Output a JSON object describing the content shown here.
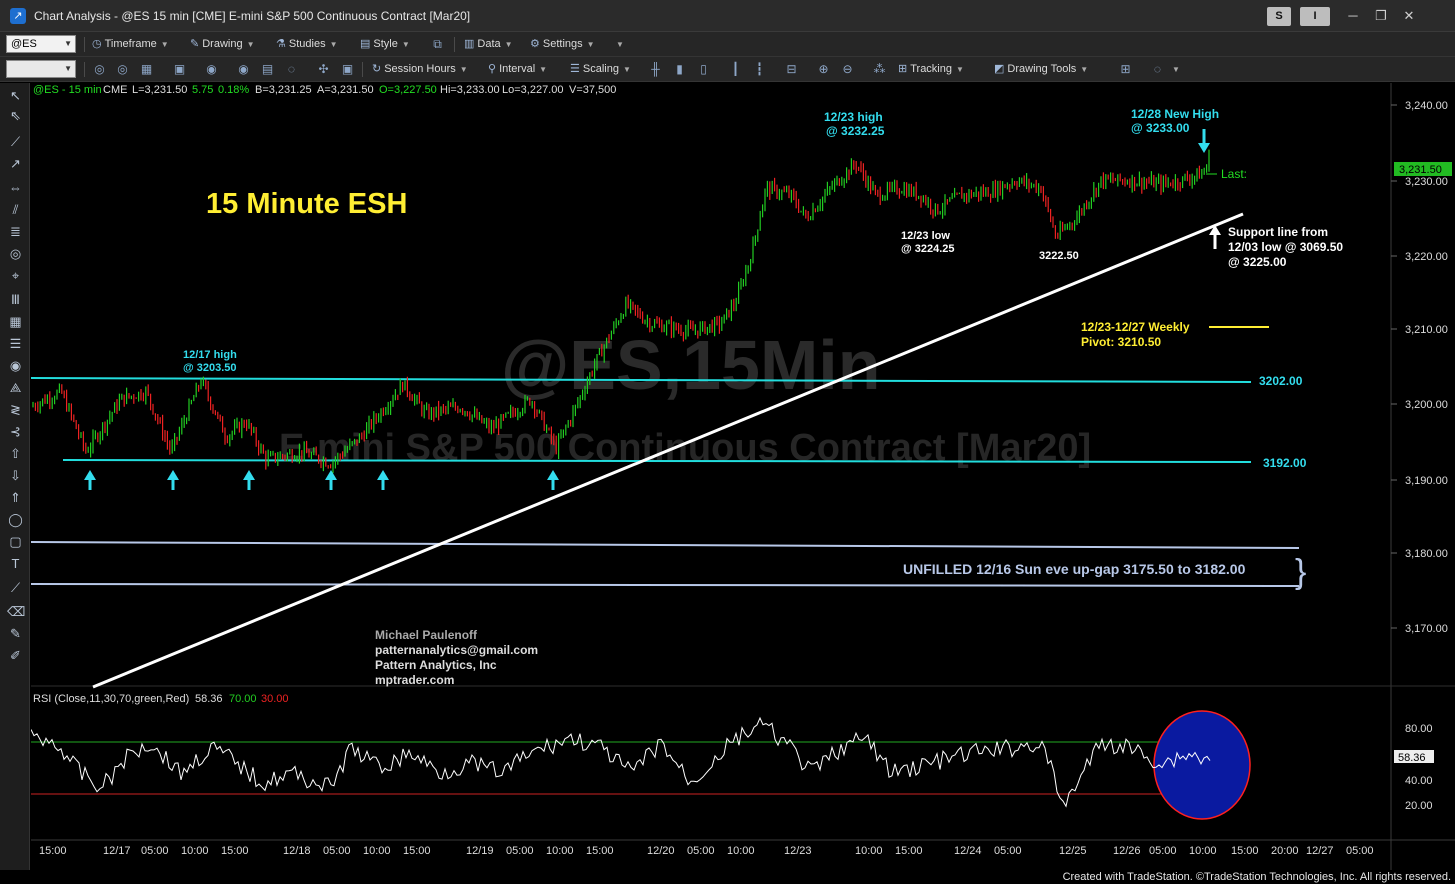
{
  "window": {
    "title": "Chart Analysis - @ES 15 min [CME] E-mini S&P 500 Continuous Contract [Mar20]",
    "s_button": "S",
    "i_button": "I",
    "minimize": "─",
    "restore": "❐",
    "close": "✕"
  },
  "toolbar1": {
    "symbol": "@ES",
    "items": [
      "Timeframe",
      "Drawing",
      "Studies",
      "Style",
      "Data",
      "Settings"
    ]
  },
  "toolbar2": {
    "items": [
      "Session Hours",
      "Interval",
      "Scaling",
      "Tracking",
      "Drawing Tools"
    ]
  },
  "quote_line": {
    "symbol": "@ES - 15 min",
    "exchange": "CME",
    "last": "L=3,231.50",
    "change": "5.75",
    "pct": "0.18%",
    "bid": "B=3,231.25",
    "ask": "A=3,231.50",
    "open": "O=3,227.50",
    "high": "Hi=3,233.00",
    "low": "Lo=3,227.00",
    "volume": "V=37,500"
  },
  "watermark": {
    "symbol": "@ES,15Min",
    "name": "E-mini S&P 500 Continuous Contract [Mar20]"
  },
  "annotations": {
    "title": "15 Minute ESH",
    "high_1223_l1": "12/23 high",
    "high_1223_l2": "@ 3232.25",
    "high_1228_l1": "12/28 New High",
    "high_1228_l2": "@ 3233.00",
    "high_1217_l1": "12/17 high",
    "high_1217_l2": "@ 3203.50",
    "low_1223_l1": "12/23 low",
    "low_1223_l2": "@ 3224.25",
    "low_3222": "3222.50",
    "support_l1": "Support line from",
    "support_l2": "12/03 low @ 3069.50",
    "support_l3": "@ 3225.00",
    "pivot_l1": "12/23-12/27 Weekly",
    "pivot_l2": "Pivot: 3210.50",
    "level_3202": "3202.00",
    "level_3192": "3192.00",
    "gap": "UNFILLED 12/16 Sun eve up-gap 3175.50 to 3182.00",
    "gap_brace": "}",
    "last_label": "Last:",
    "last_value": "3,231.50",
    "author": "Michael Paulenoff",
    "email": "patternanalytics@gmail.com",
    "company": "Pattern Analytics, Inc",
    "site": "mptrader.com"
  },
  "rsi": {
    "label": "RSI (Close,11,30,70,green,Red)",
    "value": "58.36",
    "overbought": "70.00",
    "oversold": "30.00",
    "axis_ticks": [
      "80.00",
      "40.00",
      "20.00"
    ],
    "current_tag": "58.36"
  },
  "price_axis": {
    "ticks": [
      "3,240.00",
      "3,230.00",
      "3,220.00",
      "3,210.00",
      "3,200.00",
      "3,190.00",
      "3,180.00",
      "3,170.00"
    ]
  },
  "time_axis": {
    "labels": [
      "15:00",
      "12/17",
      "05:00",
      "10:00",
      "15:00",
      "12/18",
      "05:00",
      "10:00",
      "15:00",
      "12/19",
      "05:00",
      "10:00",
      "15:00",
      "12/20",
      "05:00",
      "10:00",
      "12/23",
      "10:00",
      "15:00",
      "12/24",
      "05:00",
      "12/25",
      "12/26",
      "05:00",
      "10:00",
      "15:00",
      "20:00",
      "12/27",
      "05:00"
    ]
  },
  "footer": {
    "credits": "Created with TradeStation. ©TradeStation Technologies, Inc. All rights reserved."
  },
  "colors": {
    "up_bar": "#22cc22",
    "down_bar": "#ee2222",
    "cyan_lines": "#22dddd",
    "annotation_yellow": "#ffee33",
    "annotation_cyan": "#33ddee",
    "gap_lines": "#b8c8e8",
    "rsi_line": "#ffffff",
    "rsi_circle_fill": "#0a1aa0",
    "rsi_circle_stroke": "#ff2020"
  }
}
